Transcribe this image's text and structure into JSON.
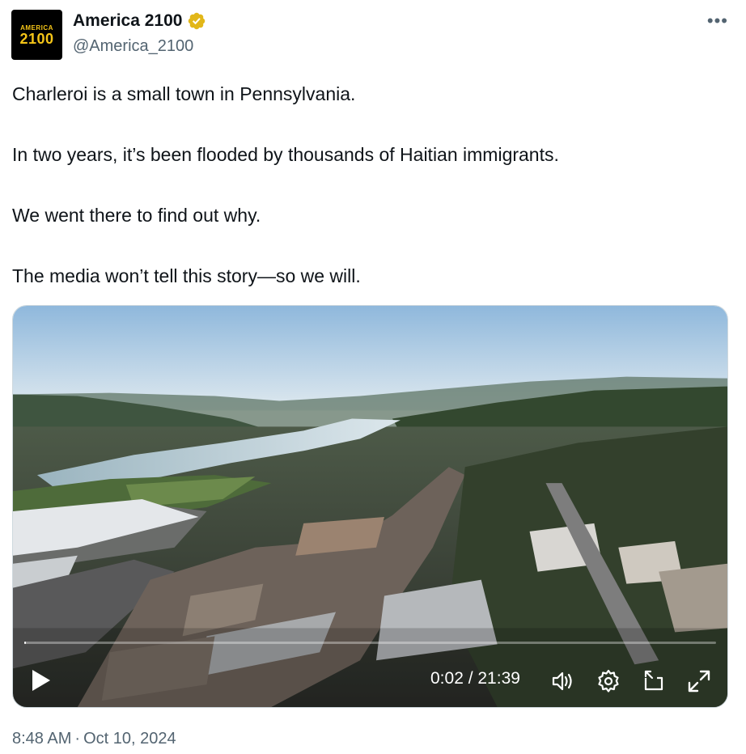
{
  "author": {
    "display_name": "America 2100",
    "handle": "@America_2100",
    "avatar_top": "AMERICA",
    "avatar_bottom": "2100",
    "verified": true,
    "verified_color": "#e2b719"
  },
  "more_label": "•••",
  "tweet": {
    "lines": [
      "Charleroi is a small town in Pennsylvania.",
      "In two years, it’s been flooded by thousands of Haitian immigrants.",
      "We went there to find out why.",
      "The media won’t tell this story—so we will."
    ]
  },
  "video": {
    "time_display": "0:02 / 21:39",
    "progress_fraction": 0.0015
  },
  "meta": {
    "time": "8:48 AM",
    "separator": "·",
    "date": "Oct 10, 2024"
  }
}
